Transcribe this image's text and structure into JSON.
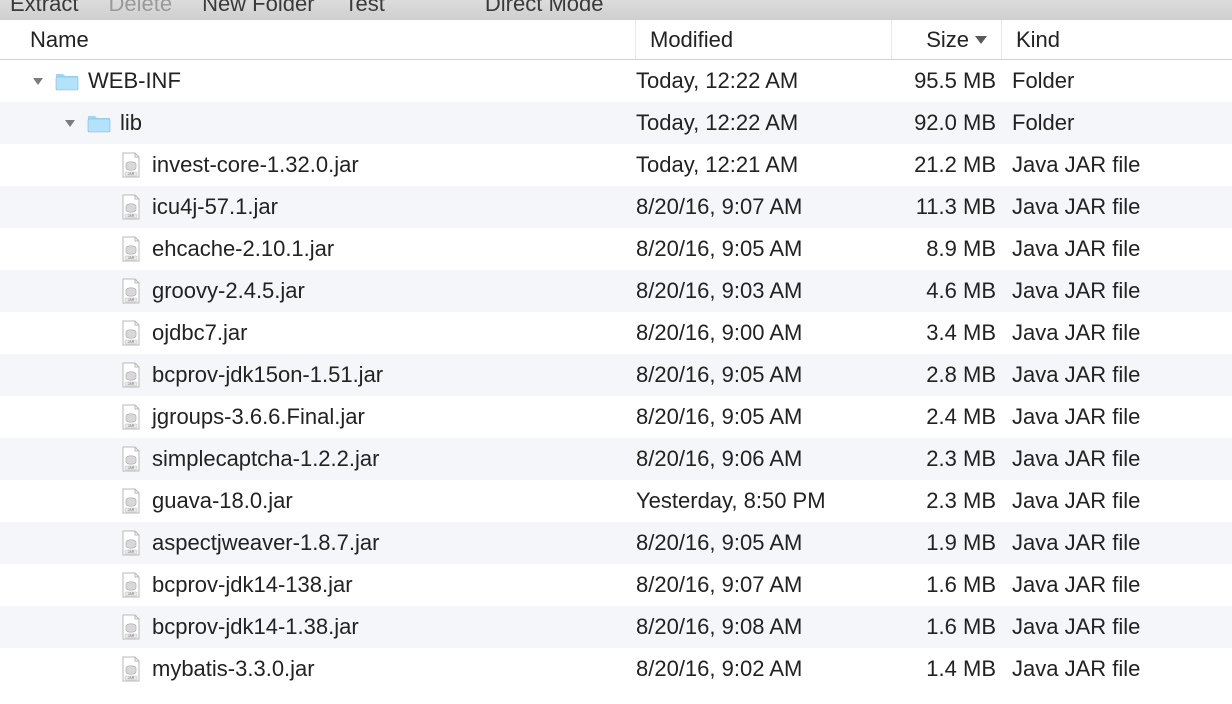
{
  "toolbar": {
    "extract": "Extract",
    "delete": "Delete",
    "new_folder": "New Folder",
    "test": "Test",
    "direct_mode": "Direct Mode"
  },
  "columns": {
    "name": "Name",
    "modified": "Modified",
    "size": "Size",
    "kind": "Kind"
  },
  "tree": [
    {
      "type": "folder",
      "level": 0,
      "expanded": true,
      "name": "WEB-INF",
      "modified": "Today, 12:22 AM",
      "size": "95.5 MB",
      "kind": "Folder"
    },
    {
      "type": "folder",
      "level": 1,
      "expanded": true,
      "name": "lib",
      "modified": "Today, 12:22 AM",
      "size": "92.0 MB",
      "kind": "Folder"
    },
    {
      "type": "jar",
      "level": 2,
      "name": "invest-core-1.32.0.jar",
      "modified": "Today, 12:21 AM",
      "size": "21.2 MB",
      "kind": "Java JAR file"
    },
    {
      "type": "jar",
      "level": 2,
      "name": "icu4j-57.1.jar",
      "modified": "8/20/16, 9:07 AM",
      "size": "11.3 MB",
      "kind": "Java JAR file"
    },
    {
      "type": "jar",
      "level": 2,
      "name": "ehcache-2.10.1.jar",
      "modified": "8/20/16, 9:05 AM",
      "size": "8.9 MB",
      "kind": "Java JAR file"
    },
    {
      "type": "jar",
      "level": 2,
      "name": "groovy-2.4.5.jar",
      "modified": "8/20/16, 9:03 AM",
      "size": "4.6 MB",
      "kind": "Java JAR file"
    },
    {
      "type": "jar",
      "level": 2,
      "name": "ojdbc7.jar",
      "modified": "8/20/16, 9:00 AM",
      "size": "3.4 MB",
      "kind": "Java JAR file"
    },
    {
      "type": "jar",
      "level": 2,
      "name": "bcprov-jdk15on-1.51.jar",
      "modified": "8/20/16, 9:05 AM",
      "size": "2.8 MB",
      "kind": "Java JAR file"
    },
    {
      "type": "jar",
      "level": 2,
      "name": "jgroups-3.6.6.Final.jar",
      "modified": "8/20/16, 9:05 AM",
      "size": "2.4 MB",
      "kind": "Java JAR file"
    },
    {
      "type": "jar",
      "level": 2,
      "name": "simplecaptcha-1.2.2.jar",
      "modified": "8/20/16, 9:06 AM",
      "size": "2.3 MB",
      "kind": "Java JAR file"
    },
    {
      "type": "jar",
      "level": 2,
      "name": "guava-18.0.jar",
      "modified": "Yesterday, 8:50 PM",
      "size": "2.3 MB",
      "kind": "Java JAR file"
    },
    {
      "type": "jar",
      "level": 2,
      "name": "aspectjweaver-1.8.7.jar",
      "modified": "8/20/16, 9:05 AM",
      "size": "1.9 MB",
      "kind": "Java JAR file"
    },
    {
      "type": "jar",
      "level": 2,
      "name": "bcprov-jdk14-138.jar",
      "modified": "8/20/16, 9:07 AM",
      "size": "1.6 MB",
      "kind": "Java JAR file"
    },
    {
      "type": "jar",
      "level": 2,
      "name": "bcprov-jdk14-1.38.jar",
      "modified": "8/20/16, 9:08 AM",
      "size": "1.6 MB",
      "kind": "Java JAR file"
    },
    {
      "type": "jar",
      "level": 2,
      "name": "mybatis-3.3.0.jar",
      "modified": "8/20/16, 9:02 AM",
      "size": "1.4 MB",
      "kind": "Java JAR file"
    }
  ]
}
